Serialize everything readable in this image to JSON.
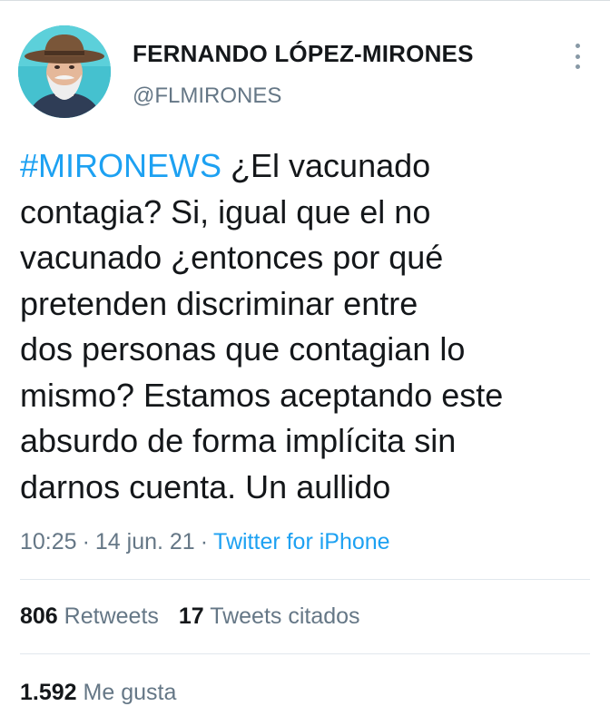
{
  "tweet": {
    "author": {
      "name": "FERNANDO LÓPEZ-MIRONES",
      "handle": "@FLMIRONES",
      "avatar_icon": "avatar-photo"
    },
    "more_icon": "vertical-ellipsis-icon",
    "text": {
      "hashtag": "#MIRONEWS",
      "line1_rest": " ¿El vacunado",
      "line2": "contagia? Si, igual que el no",
      "line3": "vacunado ¿entonces por qué",
      "line4": "pretenden discriminar entre",
      "line5": "dos personas que contagian lo",
      "line6": "mismo? Estamos aceptando este",
      "line7": "absurdo de forma implícita sin",
      "line8": "darnos cuenta. Un aullido"
    },
    "meta": {
      "time": "10:25",
      "date": "14 jun. 21",
      "separator": "·",
      "source": "Twitter for iPhone"
    },
    "stats": {
      "retweets_count": "806",
      "retweets_label": "Retweets",
      "quotes_count": "17",
      "quotes_label": "Tweets citados",
      "likes_count": "1.592",
      "likes_label": "Me gusta"
    },
    "colors": {
      "link": "#1da1f2",
      "secondary_text": "#657786",
      "primary_text": "#14171a",
      "divider": "#e1e8ed"
    }
  }
}
